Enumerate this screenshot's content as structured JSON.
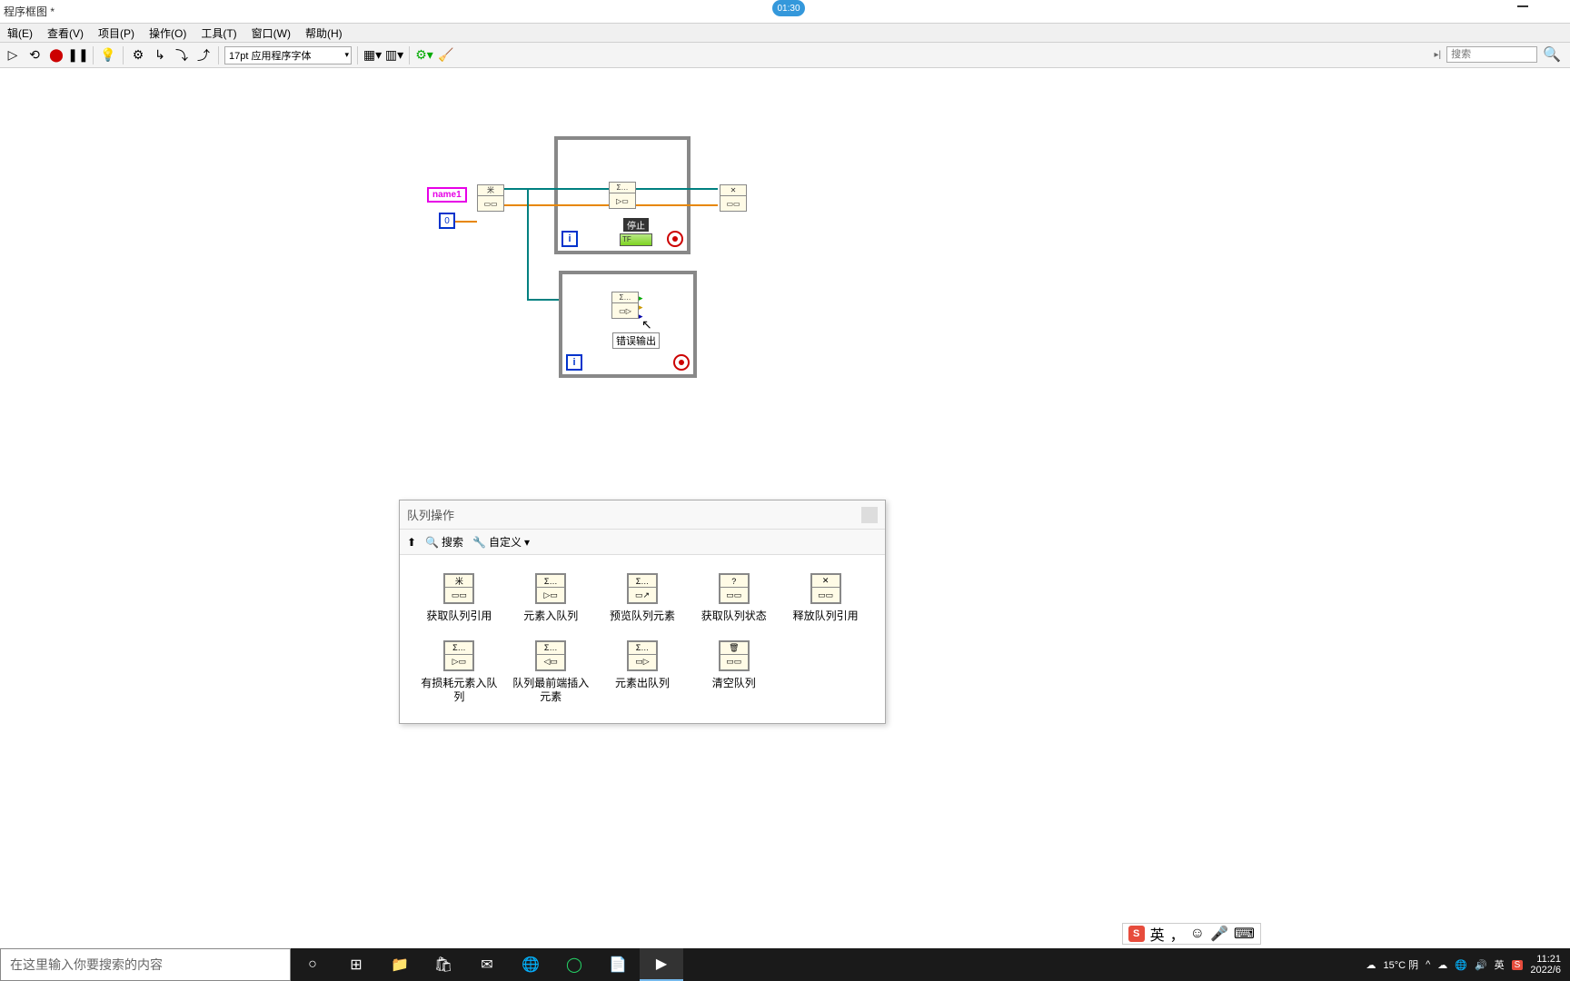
{
  "title": "程序框图 *",
  "video_time": "01:30",
  "menu": {
    "edit": "辑(E)",
    "view": "查看(V)",
    "project": "项目(P)",
    "operate": "操作(O)",
    "tools": "工具(T)",
    "window": "窗口(W)",
    "help": "帮助(H)"
  },
  "toolbar": {
    "font": "17pt 应用程序字体",
    "search_placeholder": "搜索"
  },
  "diagram": {
    "name_terminal": "name1",
    "zero_terminal": "0",
    "stop_label": "停止",
    "error_out": "错误输出"
  },
  "palette": {
    "title": "队列操作",
    "search": "搜索",
    "customize": "自定义",
    "items": [
      {
        "label": "获取队列引用",
        "glyph": "米"
      },
      {
        "label": "元素入队列",
        "glyph": "Σ…"
      },
      {
        "label": "预览队列元素",
        "glyph": "Σ…"
      },
      {
        "label": "获取队列状态",
        "glyph": "?"
      },
      {
        "label": "释放队列引用",
        "glyph": "✕"
      },
      {
        "label": "有损耗元素入队列",
        "glyph": "Σ…"
      },
      {
        "label": "队列最前端插入元素",
        "glyph": "Σ…"
      },
      {
        "label": "元素出队列",
        "glyph": "Σ…"
      },
      {
        "label": "清空队列",
        "glyph": "🗑"
      }
    ]
  },
  "taskbar": {
    "search_placeholder": "在这里输入你要搜索的内容",
    "weather": "15°C 阴",
    "time": "11:21",
    "date": "2022/6",
    "ime_lang": "英"
  }
}
